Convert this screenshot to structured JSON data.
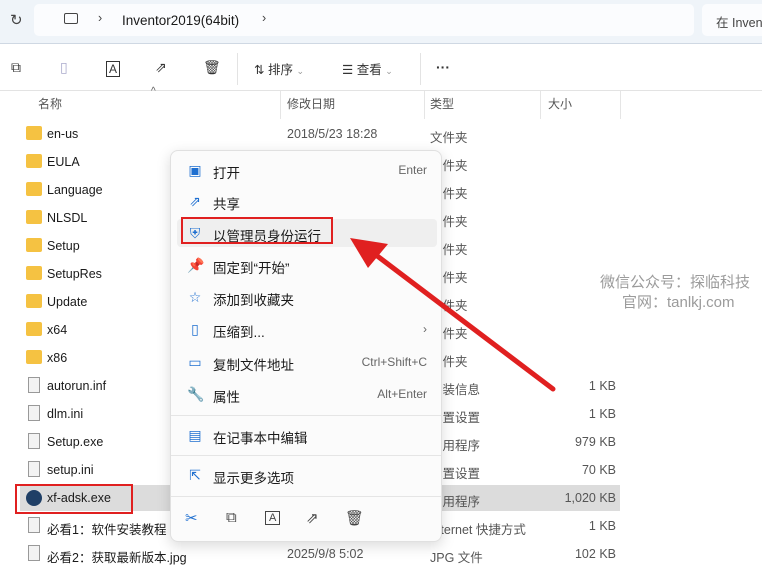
{
  "address": {
    "path": "Inventor2019(64bit)",
    "search_placeholder": "在 Inven"
  },
  "toolbar": {
    "sort": "排序",
    "view": "查看",
    "more": "···"
  },
  "columns": {
    "name": "名称",
    "date": "修改日期",
    "type": "类型",
    "size": "大小"
  },
  "files": [
    {
      "name": "en-us",
      "date": "2018/5/23 18:28",
      "type": "文件夹",
      "size": "",
      "kind": "folder"
    },
    {
      "name": "EULA",
      "date": "",
      "type": "文件夹",
      "size": "",
      "kind": "folder"
    },
    {
      "name": "Language",
      "date": "",
      "type": "文件夹",
      "size": "",
      "kind": "folder"
    },
    {
      "name": "NLSDL",
      "date": "",
      "type": "文件夹",
      "size": "",
      "kind": "folder"
    },
    {
      "name": "Setup",
      "date": "",
      "type": "文件夹",
      "size": "",
      "kind": "folder"
    },
    {
      "name": "SetupRes",
      "date": "",
      "type": "文件夹",
      "size": "",
      "kind": "folder"
    },
    {
      "name": "Update",
      "date": "",
      "type": "文件夹",
      "size": "",
      "kind": "folder"
    },
    {
      "name": "x64",
      "date": "",
      "type": "文件夹",
      "size": "",
      "kind": "folder"
    },
    {
      "name": "x86",
      "date": "",
      "type": "文件夹",
      "size": "",
      "kind": "folder"
    },
    {
      "name": "autorun.inf",
      "date": "",
      "type": "安装信息",
      "size": "1 KB",
      "kind": "file"
    },
    {
      "name": "dlm.ini",
      "date": "",
      "type": "配置设置",
      "size": "1 KB",
      "kind": "file"
    },
    {
      "name": "Setup.exe",
      "date": "",
      "type": "应用程序",
      "size": "979 KB",
      "kind": "file"
    },
    {
      "name": "setup.ini",
      "date": "",
      "type": "配置设置",
      "size": "70 KB",
      "kind": "file"
    },
    {
      "name": "xf-adsk.exe",
      "date": "",
      "type": "应用程序",
      "size": "1,020 KB",
      "kind": "exe"
    },
    {
      "name": "必看1：软件安装教程",
      "date": "",
      "type": "Internet 快捷方式",
      "size": "1 KB",
      "kind": "file"
    },
    {
      "name": "必看2：获取最新版本.jpg",
      "date": "2025/9/8 5:02",
      "type": "JPG 文件",
      "size": "102 KB",
      "kind": "file"
    }
  ],
  "menu": [
    {
      "label": "打开",
      "shortcut": "Enter",
      "icon": "open-icon"
    },
    {
      "label": "共享",
      "shortcut": "",
      "icon": "share-icon"
    },
    {
      "label": "以管理员身份运行",
      "shortcut": "",
      "icon": "shield-icon"
    },
    {
      "label": "固定到“开始”",
      "shortcut": "",
      "icon": "pin-icon"
    },
    {
      "label": "添加到收藏夹",
      "shortcut": "",
      "icon": "star-icon"
    },
    {
      "label": "压缩到...",
      "shortcut": "›",
      "icon": "zip-icon"
    },
    {
      "label": "复制文件地址",
      "shortcut": "Ctrl+Shift+C",
      "icon": "copy-path-icon"
    },
    {
      "label": "属性",
      "shortcut": "Alt+Enter",
      "icon": "wrench-icon"
    },
    {
      "label": "在记事本中编辑",
      "shortcut": "",
      "icon": "notepad-icon"
    },
    {
      "label": "显示更多选项",
      "shortcut": "",
      "icon": "more-options-icon"
    }
  ],
  "watermark": {
    "line1": "微信公众号：探临科技",
    "line2": "官网：tanlkj.com"
  },
  "colors": {
    "highlight": "#e02020",
    "accent": "#1e6fd0"
  }
}
